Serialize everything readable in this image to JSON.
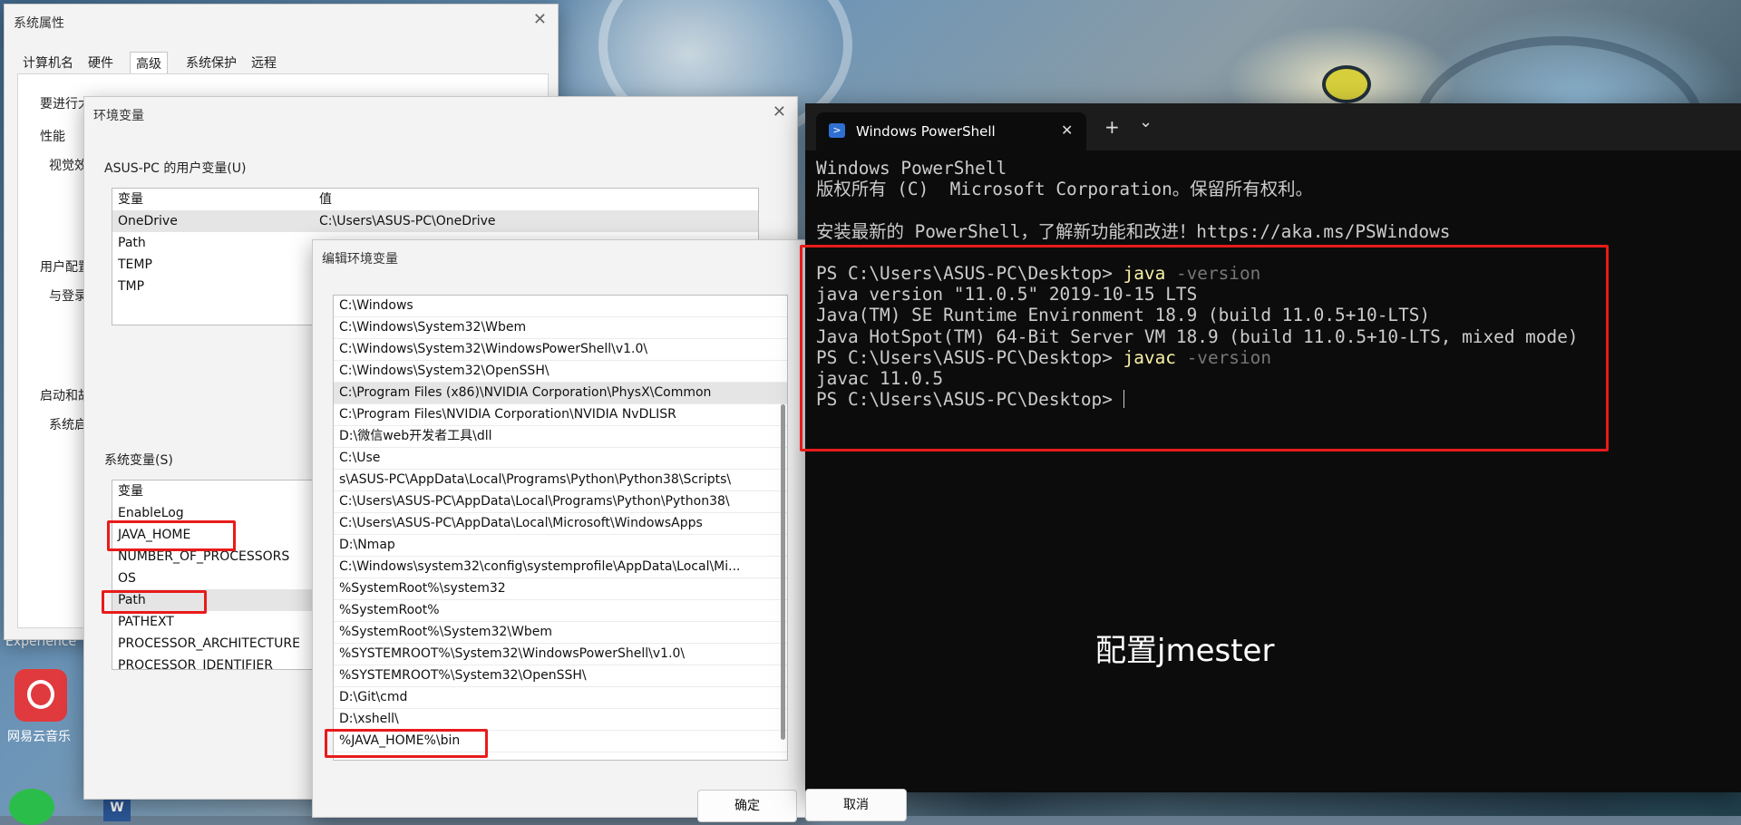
{
  "desktop": {
    "experience_text": "Experience",
    "netease_label": "网易云音乐",
    "word_label": "W"
  },
  "system_properties": {
    "title": "系统属性",
    "close": "✕",
    "tabs": [
      "计算机名",
      "硬件",
      "高级",
      "系统保护",
      "远程"
    ],
    "active_tab": "高级",
    "admin_note": "要进行大多数更改，你必须作为管理员登录。",
    "performance_title": "性能",
    "performance_text": "视觉效",
    "profile_title": "用户配置",
    "profile_text": "与登录",
    "startup_title": "启动和故",
    "startup_text": "系统启"
  },
  "env_vars": {
    "title": "环境变量",
    "close": "✕",
    "user_section": "ASUS-PC 的用户变量(U)",
    "col_var": "变量",
    "col_val": "值",
    "user_vars": [
      {
        "name": "OneDrive",
        "value": "C:\\Users\\ASUS-PC\\OneDrive"
      },
      {
        "name": "Path",
        "value": ""
      },
      {
        "name": "TEMP",
        "value": ""
      },
      {
        "name": "TMP",
        "value": ""
      }
    ],
    "system_section": "系统变量(S)",
    "system_vars": [
      "EnableLog",
      "JAVA_HOME",
      "NUMBER_OF_PROCESSORS",
      "OS",
      "Path",
      "PATHEXT",
      "PROCESSOR_ARCHITECTURE",
      "PROCESSOR_IDENTIFIER"
    ],
    "selected_system_var": "Path"
  },
  "edit_env": {
    "title": "编辑环境变量",
    "entries": [
      "C:\\Windows",
      "C:\\Windows\\System32\\Wbem",
      "C:\\Windows\\System32\\WindowsPowerShell\\v1.0\\",
      "C:\\Windows\\System32\\OpenSSH\\",
      "C:\\Program Files (x86)\\NVIDIA Corporation\\PhysX\\Common",
      "C:\\Program Files\\NVIDIA Corporation\\NVIDIA NvDLISR",
      "D:\\微信web开发者工具\\dll",
      "C:\\Use",
      "s\\ASUS-PC\\AppData\\Local\\Programs\\Python\\Python38\\Scripts\\",
      "C:\\Users\\ASUS-PC\\AppData\\Local\\Programs\\Python\\Python38\\",
      "C:\\Users\\ASUS-PC\\AppData\\Local\\Microsoft\\WindowsApps",
      "D:\\Nmap",
      "C:\\Windows\\system32\\config\\systemprofile\\AppData\\Local\\Mi...",
      "%SystemRoot%\\system32",
      "%SystemRoot%",
      "%SystemRoot%\\System32\\Wbem",
      "%SYSTEMROOT%\\System32\\WindowsPowerShell\\v1.0\\",
      "%SYSTEMROOT%\\System32\\OpenSSH\\",
      "D:\\Git\\cmd",
      "D:\\xshell\\",
      "%JAVA_HOME%\\bin"
    ],
    "selected_index": 4,
    "ok_label": "确定",
    "cancel_label": "取消"
  },
  "terminal": {
    "tab_title": "Windows PowerShell",
    "tab_close": "✕",
    "new_tab": "+",
    "dropdown": "⌄",
    "header_line1": "Windows PowerShell",
    "header_line2": "版权所有 (C)  Microsoft Corporation。保留所有权利。",
    "header_line3": "安装最新的 PowerShell，了解新功能和改进！https://aka.ms/PSWindows",
    "prompt": "PS C:\\Users\\ASUS-PC\\Desktop> ",
    "cmd1": "java",
    "cmd1_arg": " -version",
    "out1": "java version \"11.0.5\" 2019-10-15 LTS",
    "out2": "Java(TM) SE Runtime Environment 18.9 (build 11.0.5+10-LTS)",
    "out3": "Java HotSpot(TM) 64-Bit Server VM 18.9 (build 11.0.5+10-LTS, mixed mode)",
    "cmd2": "javac",
    "cmd2_arg": " -version",
    "out4": "javac 11.0.5",
    "note": "配置jmester"
  },
  "colors": {
    "highlight_box": "#e81b1b",
    "terminal_bg": "#0c0c0c",
    "command": "#f9f1a5",
    "argument": "#767676"
  }
}
